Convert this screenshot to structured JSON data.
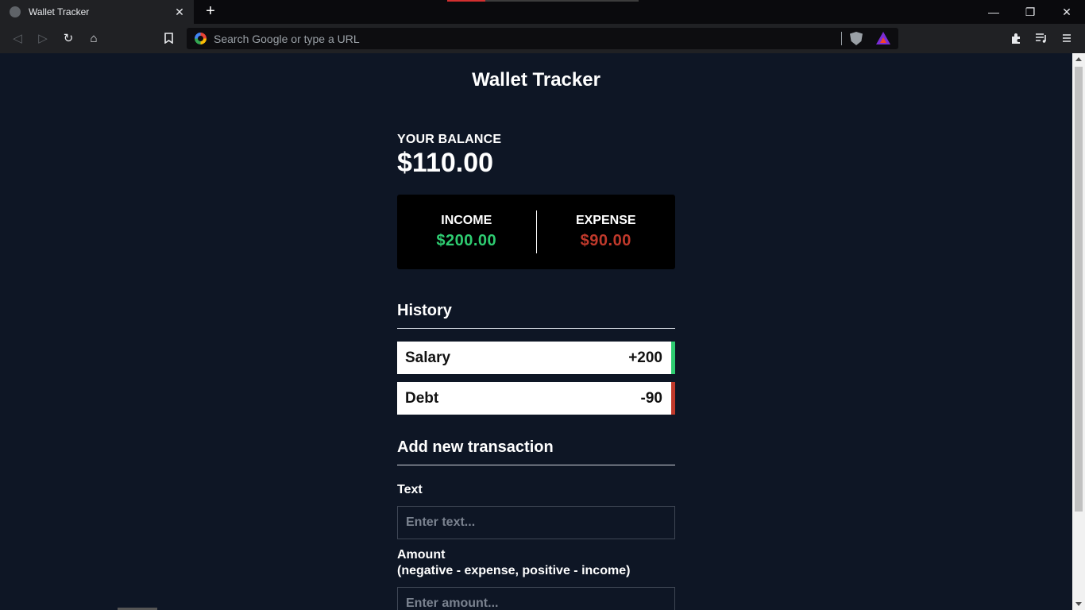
{
  "browser": {
    "tab_title": "Wallet Tracker",
    "new_tab_label": "+",
    "omnibox_placeholder": "Search Google or type a URL",
    "window_controls": {
      "minimize": "—",
      "restore": "❐",
      "close": "✕"
    },
    "nav": {
      "back": "◁",
      "forward": "▷",
      "reload": "↻",
      "home": "⌂"
    }
  },
  "app": {
    "title": "Wallet Tracker",
    "balance": {
      "label": "YOUR BALANCE",
      "value": "$110.00"
    },
    "income": {
      "label": "INCOME",
      "value": "$200.00",
      "color": "#2ecc71"
    },
    "expense": {
      "label": "EXPENSE",
      "value": "$90.00",
      "color": "#c0392b"
    },
    "history": {
      "heading": "History",
      "items": [
        {
          "text": "Salary",
          "amount": "+200",
          "type": "plus"
        },
        {
          "text": "Debt",
          "amount": "-90",
          "type": "minus"
        }
      ]
    },
    "form": {
      "heading": "Add new transaction",
      "text_label": "Text",
      "text_placeholder": "Enter text...",
      "amount_label": "Amount",
      "amount_hint": "(negative - expense, positive - income)",
      "amount_placeholder": "Enter amount..."
    }
  }
}
